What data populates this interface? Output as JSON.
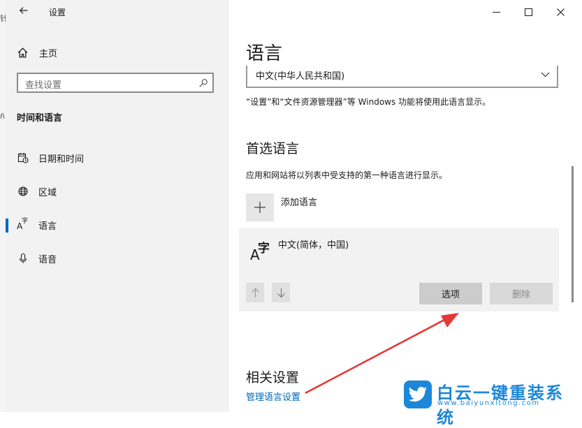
{
  "window": {
    "title": "设置",
    "controls": {
      "minimize": "minimize-icon",
      "maximize": "maximize-icon",
      "close": "close-icon"
    }
  },
  "background_window": {
    "glyph_1": "针",
    "glyph_2": "ñ"
  },
  "sidebar": {
    "back_icon": "back-arrow-icon",
    "home_label": "主页",
    "search_placeholder": "查找设置",
    "section_title": "时间和语言",
    "items": [
      {
        "label": "日期和时间",
        "icon": "calendar-clock-icon"
      },
      {
        "label": "区域",
        "icon": "globe-icon"
      },
      {
        "label": "语言",
        "icon": "language-icon",
        "icon_glyph_a": "A",
        "icon_glyph_z": "字",
        "selected": true
      },
      {
        "label": "语音",
        "icon": "microphone-icon"
      }
    ]
  },
  "main": {
    "title": "语言",
    "display_language": "中文(中华人民共和国)",
    "display_language_note": "“设置”和“文件资源管理器”等 Windows 功能将使用此语言显示。",
    "preferred_title": "首选语言",
    "preferred_desc": "应用和网站将以列表中受支持的第一种语言进行显示。",
    "add_language_label": "添加语言",
    "languages": [
      {
        "name": "中文(简体，中国)",
        "icon_glyph_a": "A",
        "icon_glyph_z": "字"
      }
    ],
    "options_label": "选项",
    "remove_label": "删除",
    "related_title": "相关设置",
    "related_link": "管理语言设置"
  },
  "watermark": {
    "brand": "白云一键重装系统",
    "url": "www.baiyunxitong.com"
  },
  "colors": {
    "accent": "#0067c0",
    "link": "#0067b8",
    "annotation": "#e53935",
    "watermark": "#1c87d8"
  }
}
